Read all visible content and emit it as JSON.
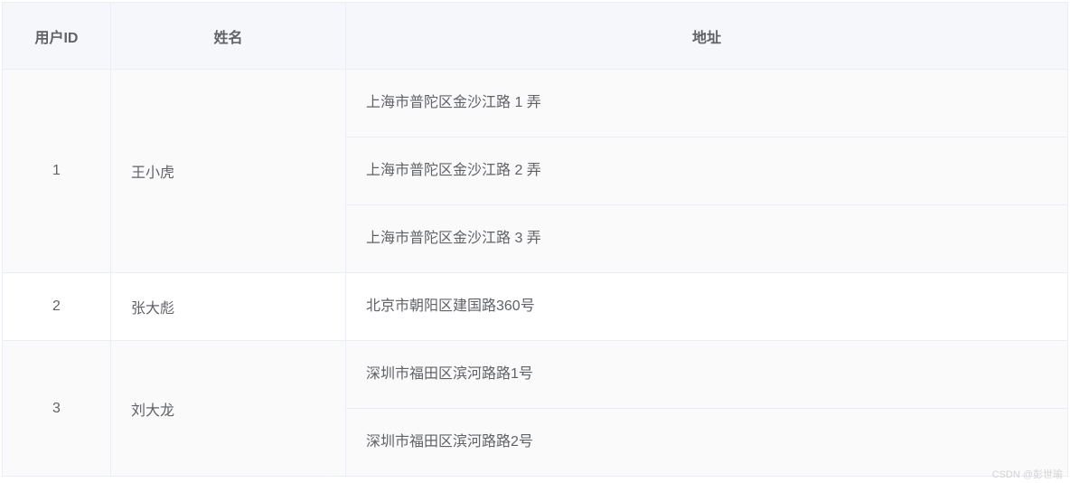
{
  "table": {
    "headers": {
      "id": "用户ID",
      "name": "姓名",
      "address": "地址"
    },
    "rows": [
      {
        "id": "1",
        "name": "王小虎",
        "addresses": [
          "上海市普陀区金沙江路 1 弄",
          "上海市普陀区金沙江路 2 弄",
          "上海市普陀区金沙江路 3 弄"
        ]
      },
      {
        "id": "2",
        "name": "张大彪",
        "addresses": [
          "北京市朝阳区建国路360号"
        ]
      },
      {
        "id": "3",
        "name": "刘大龙",
        "addresses": [
          "深圳市福田区滨河路路1号",
          "深圳市福田区滨河路路2号"
        ]
      }
    ]
  },
  "watermark": "CSDN @彭世瑜"
}
